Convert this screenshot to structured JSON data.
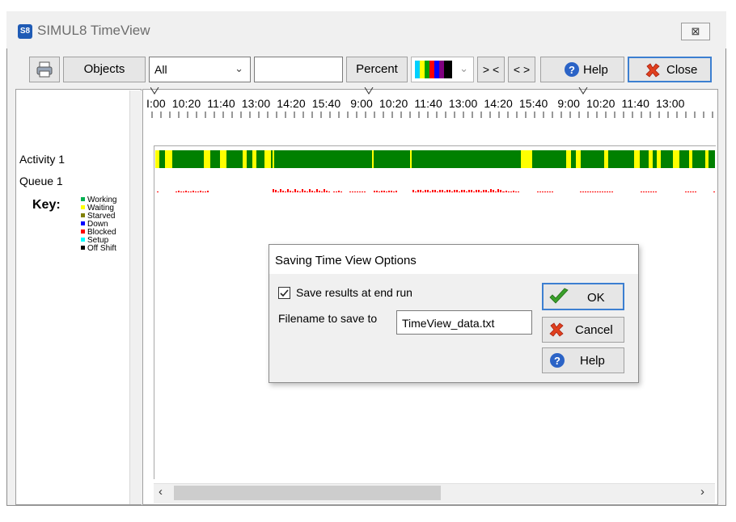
{
  "window": {
    "badge": "S8",
    "title": "SIMUL8 TimeView",
    "close_glyph": "⊠"
  },
  "toolbar": {
    "objects_label": "Objects",
    "filter_select": {
      "value": "All"
    },
    "search_value": "",
    "percent_label": "Percent",
    "narrow_label": "> <",
    "widen_label": "< >",
    "help_label": "Help",
    "close_label": "Close"
  },
  "sidebar": {
    "rows": [
      "Activity 1",
      "Queue 1"
    ],
    "key_label": "Key:",
    "key_items": [
      {
        "label": "Working",
        "color": "#00b050"
      },
      {
        "label": "Waiting",
        "color": "#ffff00"
      },
      {
        "label": "Starved",
        "color": "#808000"
      },
      {
        "label": "Down",
        "color": "#0000ff"
      },
      {
        "label": "Blocked",
        "color": "#ff0000"
      },
      {
        "label": "Setup",
        "color": "#00ffff"
      },
      {
        "label": "Off Shift",
        "color": "#000000"
      }
    ]
  },
  "timeline": {
    "scale_text": "I:00  10:20  11:40  13:00  14:20  15:40   9:00  10:20  11:40  13:00  14:20  15:40   9:00  10:20  11:40  13:00",
    "colors": {
      "working": "#008000",
      "waiting": "#ffff00",
      "queue": "#ff0000"
    }
  },
  "dialog": {
    "title": "Saving Time View Options",
    "checkbox_label": "Save results at end run",
    "checkbox_checked": true,
    "filename_label": "Filename to save to",
    "filename_value": "TimeView_data.txt",
    "ok_label": "OK",
    "cancel_label": "Cancel",
    "help_label": "Help"
  }
}
